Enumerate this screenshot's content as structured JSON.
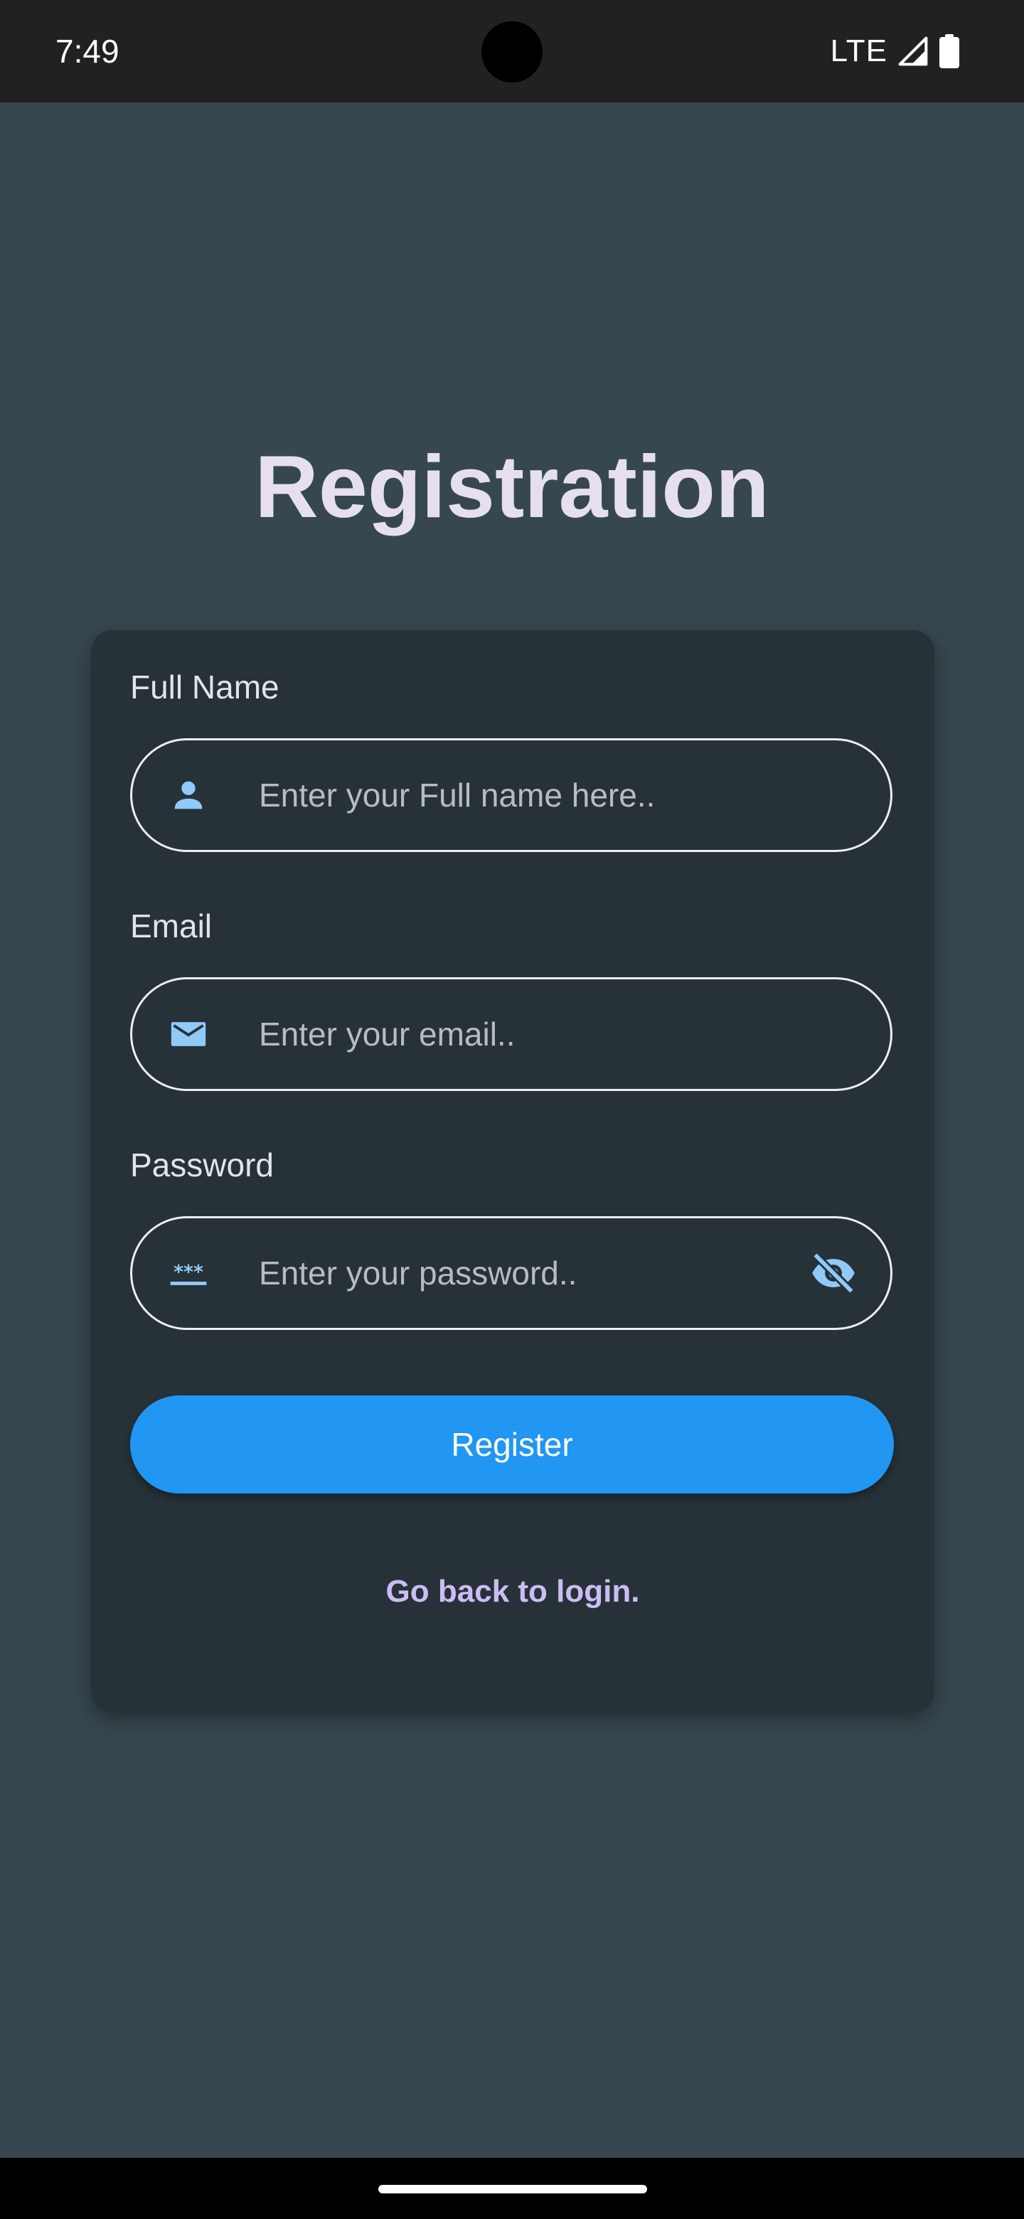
{
  "status_bar": {
    "time": "7:49",
    "network": "LTE",
    "icons": [
      "signal-icon",
      "battery-icon"
    ]
  },
  "page": {
    "title": "Registration"
  },
  "form": {
    "full_name": {
      "label": "Full Name",
      "placeholder": "Enter your Full name here..",
      "value": "",
      "icon": "person-icon"
    },
    "email": {
      "label": "Email",
      "placeholder": "Enter your email..",
      "value": "",
      "icon": "mail-icon"
    },
    "password": {
      "label": "Password",
      "placeholder": "Enter your password..",
      "value": "",
      "icon": "password-icon",
      "toggle_icon": "visibility-off-icon"
    },
    "register_label": "Register",
    "login_link": "Go back to login."
  },
  "colors": {
    "background": "#37474f",
    "card": "#263238",
    "accent": "#2196f3",
    "icon": "#90caf9",
    "link": "#cdbcf4",
    "title": "#e6e0ee"
  }
}
